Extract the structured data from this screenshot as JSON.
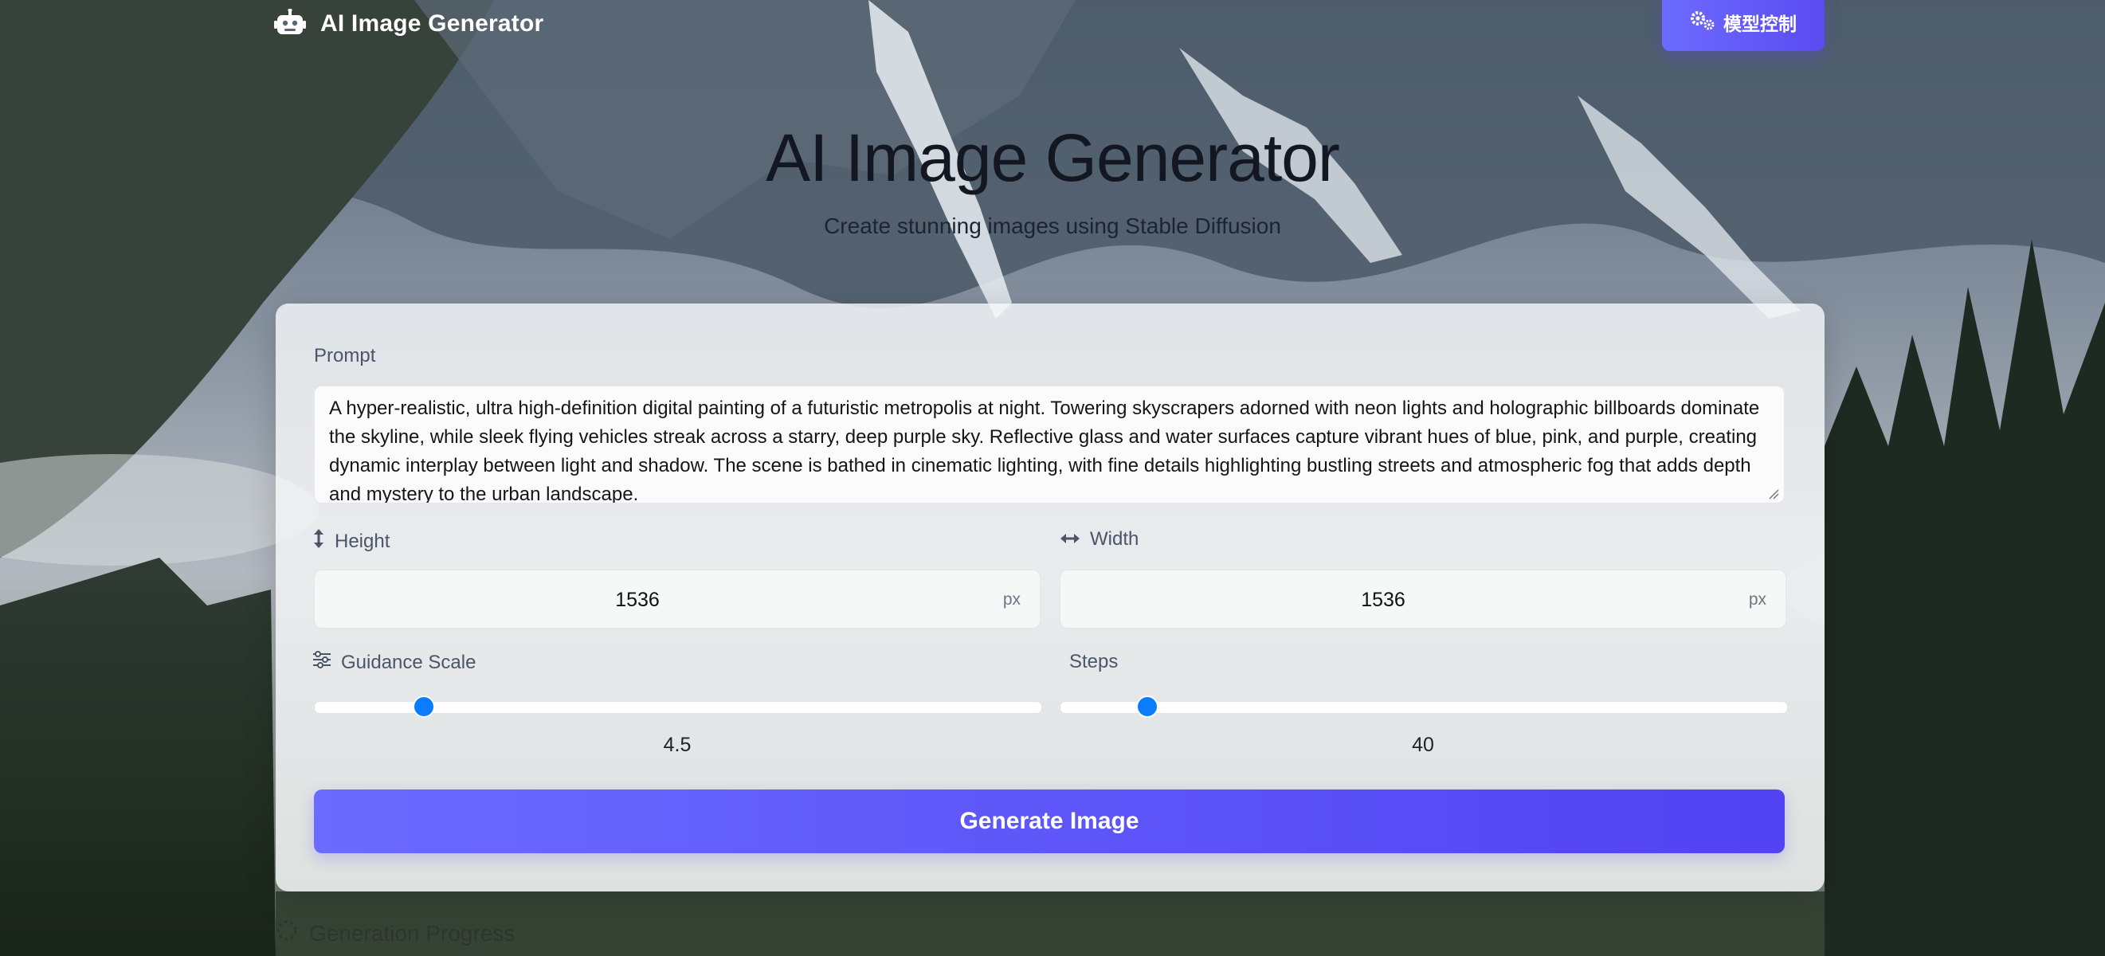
{
  "nav": {
    "brand": "AI Image Generator",
    "brand_icon": "robot-icon",
    "model_control_label": "模型控制",
    "model_control_icon": "gears-icon"
  },
  "hero": {
    "title": "AI Image Generator",
    "subtitle": "Create stunning images using Stable Diffusion"
  },
  "form": {
    "prompt_label": "Prompt",
    "prompt_value": "A hyper-realistic, ultra high-definition digital painting of a futuristic metropolis at night. Towering skyscrapers adorned with neon lights and holographic billboards dominate the skyline, while sleek flying vehicles streak across a starry, deep purple sky. Reflective glass and water surfaces capture vibrant hues of blue, pink, and purple, creating dynamic interplay between light and shadow. The scene is bathed in cinematic lighting, with fine details highlighting bustling streets and atmospheric fog that adds depth and mystery to the urban landscape.",
    "height": {
      "label": "Height",
      "value": "1536",
      "unit": "px",
      "icon": "arrows-vertical-icon"
    },
    "width": {
      "label": "Width",
      "value": "1536",
      "unit": "px",
      "icon": "arrows-horizontal-icon"
    },
    "guidance": {
      "label": "Guidance Scale",
      "value": "4.5",
      "fraction": 0.15,
      "icon": "sliders-icon"
    },
    "steps": {
      "label": "Steps",
      "value": "40",
      "fraction": 0.12
    },
    "generate_label": "Generate Image"
  },
  "progress": {
    "title": "Generation Progress",
    "icon": "spinner-icon"
  },
  "colors": {
    "accent": "#5a4bf0",
    "slider_thumb": "#0a7cff"
  }
}
